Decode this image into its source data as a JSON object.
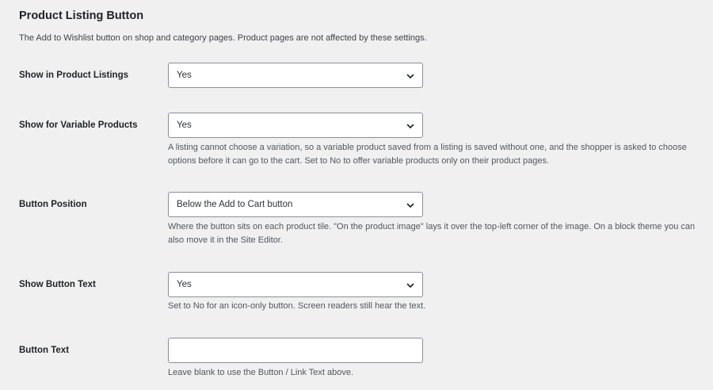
{
  "section": {
    "title": "Product Listing Button",
    "description": "The Add to Wishlist button on shop and category pages. Product pages are not affected by these settings."
  },
  "fields": [
    {
      "label": "Show in Product Listings",
      "value": "Yes",
      "help": ""
    },
    {
      "label": "Show for Variable Products",
      "value": "Yes",
      "help": "A listing cannot choose a variation, so a variable product saved from a listing is saved without one, and the shopper is asked to choose options before it can go to the cart. Set to No to offer variable products only on their product pages."
    },
    {
      "label": "Button Position",
      "value": "Below the Add to Cart button",
      "help": "Where the button sits on each product tile. \"On the product image\" lays it over the top-left corner of the image. On a block theme you can also move it in the Site Editor."
    },
    {
      "label": "Show Button Text",
      "value": "Yes",
      "help": "Set to No for an icon-only button. Screen readers still hear the text."
    },
    {
      "label": "Button Text",
      "value": "",
      "help": "Leave blank to use the Button / Link Text above."
    }
  ],
  "icons": {
    "dropdown": "chevron-down-icon"
  },
  "colors": {
    "background": "#f0f0f1",
    "text": "#1d2327",
    "help_text": "#50575e",
    "input_border": "#8c8f94"
  }
}
